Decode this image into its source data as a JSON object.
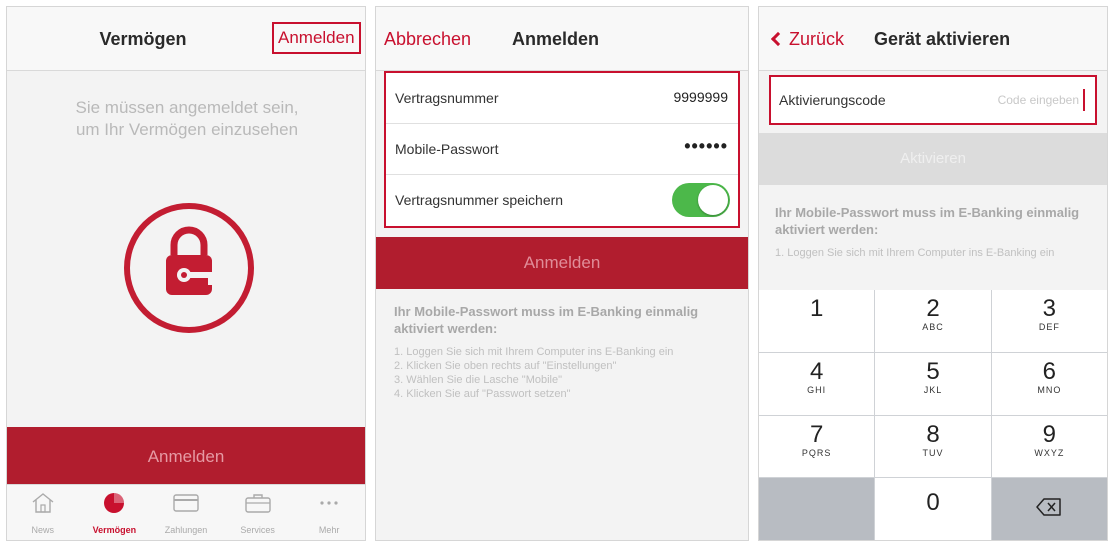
{
  "screen1": {
    "title": "Vermögen",
    "login_link": "Anmelden",
    "info_text": "Sie müssen angemeldet sein, um Ihr Vermögen einzusehen",
    "login_button": "Anmelden",
    "tabs": [
      {
        "label": "News",
        "icon": "home-icon"
      },
      {
        "label": "Vermögen",
        "icon": "pie-chart-icon"
      },
      {
        "label": "Zahlungen",
        "icon": "card-icon"
      },
      {
        "label": "Services",
        "icon": "briefcase-icon"
      },
      {
        "label": "Mehr",
        "icon": "more-icon"
      }
    ],
    "active_tab": 1
  },
  "screen2": {
    "cancel_link": "Abbrechen",
    "title": "Anmelden",
    "rows": {
      "contract_label": "Vertragsnummer",
      "contract_value": "9999999",
      "password_label": "Mobile-Passwort",
      "password_value": "••••••",
      "save_label": "Vertragsnummer speichern",
      "save_toggle": true
    },
    "login_button": "Anmelden",
    "instructions": {
      "heading": "Ihr Mobile-Passwort muss im E-Banking einmalig aktiviert werden:",
      "steps": [
        "1. Loggen Sie sich mit Ihrem Computer ins E-Banking ein",
        "2. Klicken Sie oben rechts auf \"Einstellungen\"",
        "3. Wählen Sie die Lasche \"Mobile\"",
        "4. Klicken Sie auf \"Passwort setzen\""
      ]
    }
  },
  "screen3": {
    "back_link": "Zurück",
    "title": "Gerät aktivieren",
    "code_label": "Aktivierungscode",
    "code_placeholder": "Code eingeben",
    "activate_button": "Aktivieren",
    "instructions": {
      "heading": "Ihr Mobile-Passwort muss im E-Banking einmalig aktiviert werden:",
      "step1": "1. Loggen Sie sich mit Ihrem Computer ins E-Banking ein"
    },
    "keypad": [
      {
        "num": "1",
        "letters": ""
      },
      {
        "num": "2",
        "letters": "ABC"
      },
      {
        "num": "3",
        "letters": "DEF"
      },
      {
        "num": "4",
        "letters": "GHI"
      },
      {
        "num": "5",
        "letters": "JKL"
      },
      {
        "num": "6",
        "letters": "MNO"
      },
      {
        "num": "7",
        "letters": "PQRS"
      },
      {
        "num": "8",
        "letters": "TUV"
      },
      {
        "num": "9",
        "letters": "WXYZ"
      },
      {
        "num": "0",
        "letters": ""
      }
    ]
  },
  "colors": {
    "accent": "#c8102e",
    "button_red": "#b11d2e",
    "toggle_green": "#4cb84a"
  }
}
